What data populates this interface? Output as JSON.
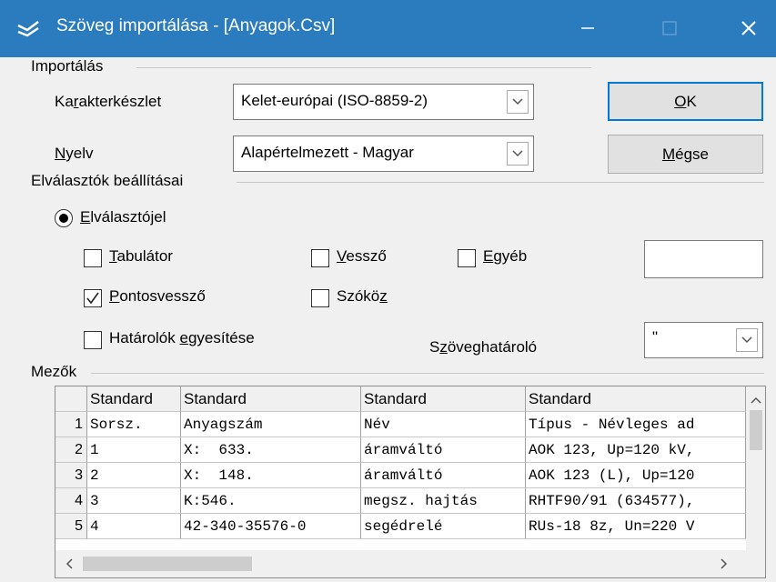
{
  "window": {
    "title": "Szöveg importálása - [Anyagok.Csv]",
    "app_icon": "libreoffice-gull-icon",
    "accent": "#2b7bbf"
  },
  "import_group": {
    "label": "Importálás",
    "charset": {
      "label_pre": "Ka",
      "label_u": "r",
      "label_post": "akterkészlet",
      "value": "Kelet-európai (ISO-8859-2)"
    },
    "language": {
      "label_pre": "",
      "label_u": "N",
      "label_post": "yelv",
      "value": "Alapértelmezett - Magyar"
    }
  },
  "buttons": {
    "ok": {
      "pre": "",
      "u": "O",
      "post": "K"
    },
    "cancel": {
      "pre": "",
      "u": "M",
      "post": "égse"
    }
  },
  "separator_group": {
    "label": "Elválasztók beállításai",
    "radio_separator": {
      "pre": "",
      "u": "E",
      "post": "lválasztójel",
      "selected": true
    },
    "tab": {
      "pre": "",
      "u": "T",
      "post": "abulátor",
      "checked": false
    },
    "comma": {
      "pre": "",
      "u": "V",
      "post": "essző",
      "checked": false
    },
    "other": {
      "pre": "",
      "u": "E",
      "post": "gyéb",
      "checked": false
    },
    "other_value": "",
    "semicolon": {
      "pre": "",
      "u": "P",
      "post": "ontosvessző",
      "checked": true
    },
    "space": {
      "pre": "Szókö",
      "u": "z",
      "post": "",
      "checked": false
    },
    "merge": {
      "pre": "Határolók ",
      "u": "e",
      "post": "gyesítése",
      "checked": false
    },
    "text_delim": {
      "pre": "S",
      "u": "z",
      "post": "öveghatároló",
      "value": "\""
    }
  },
  "fields_group": {
    "label": "Mezők",
    "headers": [
      "Standard",
      "Standard",
      "Standard",
      "Standard"
    ],
    "rows": [
      {
        "n": "1",
        "cells": [
          "Sorsz.",
          "Anyagszám",
          "Név",
          "Típus - Névleges ad"
        ]
      },
      {
        "n": "2",
        "cells": [
          "1",
          "X:  633.",
          "áramváltó",
          "AOK 123, Up=120 kV,"
        ]
      },
      {
        "n": "3",
        "cells": [
          "2",
          "X:  148.",
          "áramváltó",
          "AOK 123 (L), Up=120"
        ]
      },
      {
        "n": "4",
        "cells": [
          "3",
          "K:546.",
          "megsz. hajtás",
          "RHTF90/91 (634577),"
        ]
      },
      {
        "n": "5",
        "cells": [
          "4",
          "42-340-35576-0",
          "segédrelé",
          "RUs-18 8z, Un=220 V"
        ]
      }
    ]
  }
}
